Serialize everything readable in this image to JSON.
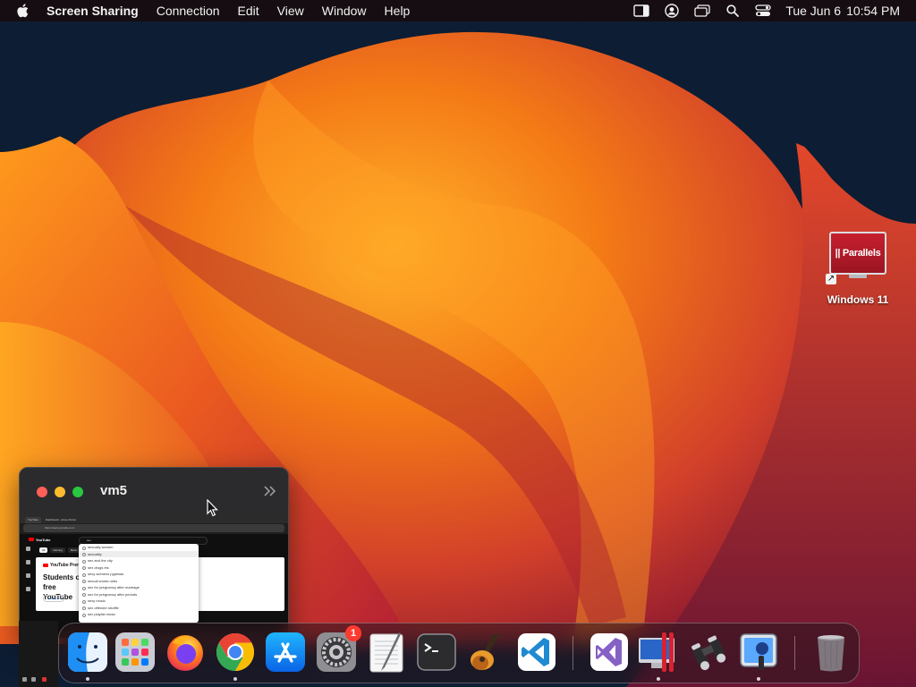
{
  "menubar": {
    "app_name": "Screen Sharing",
    "menus": [
      "Connection",
      "Edit",
      "View",
      "Window",
      "Help"
    ],
    "status_icons": [
      "screen-mirroring-icon",
      "user-icon",
      "window-icon",
      "search-icon",
      "control-center-icon"
    ],
    "clock": {
      "day": "Tue Jun 6",
      "time": "10:54 PM"
    }
  },
  "desktop": {
    "icons": [
      {
        "label": "Windows 11",
        "logo_text": "|| Parallels",
        "icon": "parallels-monitor-icon"
      }
    ]
  },
  "vm_window": {
    "title": "vm5",
    "browser": {
      "tabs": [
        "YouTube",
        "Dashboard - Azure Portal"
      ],
      "url": "https://www.youtube.com",
      "search_value": "sex",
      "chips": [
        "All",
        "Gaming",
        "Music",
        "Live",
        "Mixes",
        "Comedy",
        "Basketball"
      ],
      "suggestions": [
        "sexually women",
        "sexuality",
        "sex and the city",
        "sex drugs etc",
        "sexy womens pyjamas",
        "sexual words rules",
        "sex for pregnancy after marriage",
        "sex for pregnancy after periods",
        "sexy music",
        "sex offender shuffle",
        "sex playlist music"
      ],
      "premium_label": "YouTube Premium",
      "headline": "Students on free YouTube",
      "cta": "Get it now"
    }
  },
  "dock": {
    "apps": [
      {
        "name": "Finder",
        "icon": "finder-icon",
        "running": true
      },
      {
        "name": "Launchpad",
        "icon": "launchpad-icon",
        "running": false
      },
      {
        "name": "Firefox",
        "icon": "firefox-icon",
        "running": false
      },
      {
        "name": "Google Chrome",
        "icon": "chrome-icon",
        "running": true
      },
      {
        "name": "App Store",
        "icon": "app-store-icon",
        "running": false
      },
      {
        "name": "System Settings",
        "icon": "system-settings-icon",
        "running": false,
        "badge": "1"
      },
      {
        "name": "TextEdit",
        "icon": "textedit-icon",
        "running": false
      },
      {
        "name": "Terminal",
        "icon": "terminal-icon",
        "running": false
      },
      {
        "name": "GarageBand",
        "icon": "garageband-icon",
        "running": false
      },
      {
        "name": "Visual Studio Code",
        "icon": "vscode-icon",
        "running": false
      }
    ],
    "recent_apps": [
      {
        "name": "Visual Studio",
        "icon": "visual-studio-icon",
        "running": false
      },
      {
        "name": "Parallels Desktop",
        "icon": "parallels-desktop-icon",
        "running": true
      },
      {
        "name": "Screen Sharing",
        "icon": "screen-sharing-icon",
        "running": false
      },
      {
        "name": "Preview",
        "icon": "preview-icon",
        "running": true
      }
    ],
    "trash": {
      "name": "Trash",
      "icon": "trash-icon"
    }
  },
  "colors": {
    "menubar_bg": "#160c0e",
    "wallpaper_orange": "#f07a16",
    "wallpaper_red": "#c8283a",
    "wallpaper_navy": "#0d1d33",
    "badge_red": "#ff3b30"
  }
}
